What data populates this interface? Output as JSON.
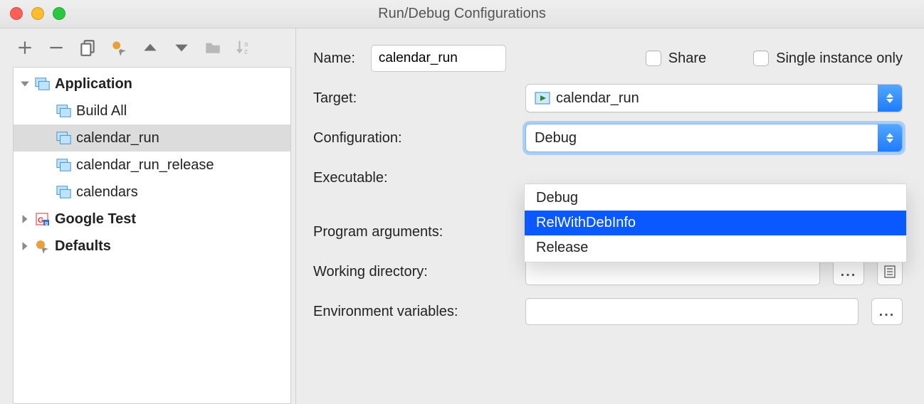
{
  "window": {
    "title": "Run/Debug Configurations"
  },
  "tree": {
    "root_app": "Application",
    "children": [
      "Build All",
      "calendar_run",
      "calendar_run_release",
      "calendars"
    ],
    "selected_index": 1,
    "google_test": "Google Test",
    "defaults": "Defaults"
  },
  "form": {
    "name_label": "Name:",
    "name_value": "calendar_run",
    "share_label": "Share",
    "share_checked": false,
    "single_label": "Single instance only",
    "single_checked": false,
    "target_label": "Target:",
    "target_value": "calendar_run",
    "config_label": "Configuration:",
    "config_value": "Debug",
    "config_options": [
      "Debug",
      "RelWithDebInfo",
      "Release"
    ],
    "config_highlight_index": 1,
    "executable_label": "Executable:",
    "progargs_label": "Program arguments:",
    "progargs_value": "",
    "workdir_label": "Working directory:",
    "workdir_value": "",
    "envvars_label": "Environment variables:",
    "envvars_value": "",
    "dots": "...",
    "dots2": "..."
  }
}
